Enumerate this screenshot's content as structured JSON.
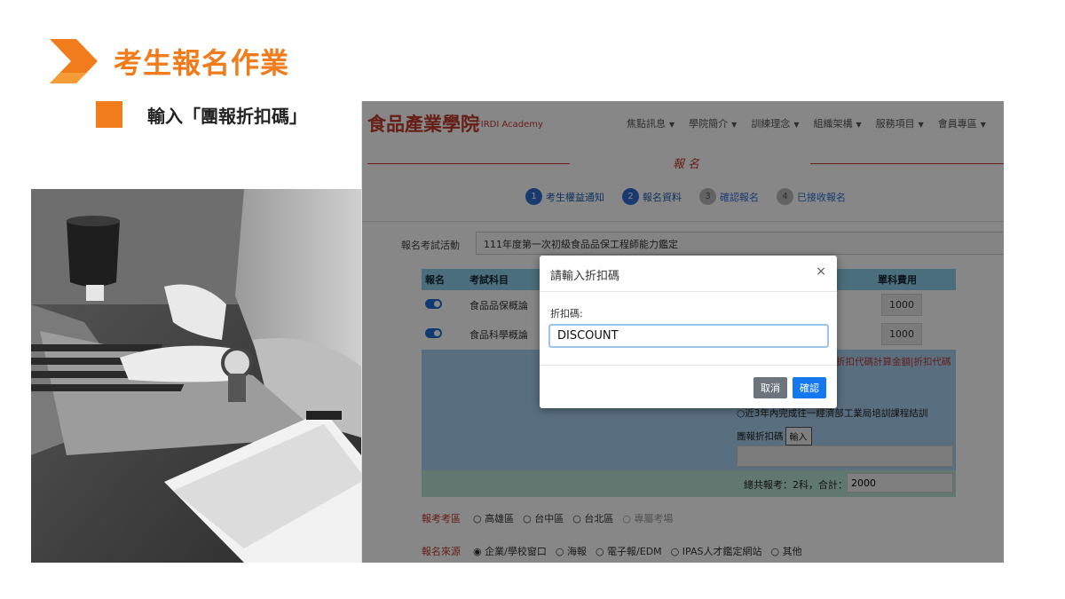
{
  "slide": {
    "title": "考生報名作業",
    "subtitle": "輸入「團報折扣碼」",
    "accent_color": "#f07c1c"
  },
  "site": {
    "logo": "食品產業學院",
    "logo_sub": "FIRDI Academy",
    "menu": [
      "焦點訊息",
      "學院簡介",
      "訓練理念",
      "組織架構",
      "服務項目",
      "會員專區"
    ],
    "section_title": "報名"
  },
  "steps": [
    {
      "num": "1",
      "label": "考生權益通知"
    },
    {
      "num": "2",
      "label": "報名資料"
    },
    {
      "num": "3",
      "label": "確認報名"
    },
    {
      "num": "4",
      "label": "已接收報名"
    }
  ],
  "event": {
    "label": "報名考試活動",
    "value": "111年度第一次初級食品品保工程師能力鑑定"
  },
  "table": {
    "headers": [
      "報名",
      "考試科目",
      "單科費用"
    ],
    "rows": [
      {
        "subject": "食品品保概論",
        "fee": "1000"
      },
      {
        "subject": "食品科學概論",
        "fee": "1000"
      }
    ]
  },
  "discount": {
    "note": "折扣代碼計算金額|折扣代碼",
    "radio_text": "近3年內完成往一經濟部工業局培訓課程結訓",
    "code_label": "團報折扣碼",
    "code_button": "輸入"
  },
  "total": {
    "label": "總共報考：2科，合計：",
    "value": "2000"
  },
  "region": {
    "label": "報考考區",
    "options": [
      "高雄區",
      "台中區",
      "台北區"
    ],
    "disabled_option": "專屬考場"
  },
  "source": {
    "label": "報名來源",
    "options": [
      "企業/學校窗口",
      "海報",
      "電子報/EDM",
      "IPAS人才鑑定網站",
      "其他"
    ]
  },
  "modal": {
    "title": "請輸入折扣碼",
    "close": "×",
    "field_label": "折扣碼:",
    "field_value": "DISCOUNT",
    "cancel_label": "取消",
    "confirm_label": "確認"
  }
}
